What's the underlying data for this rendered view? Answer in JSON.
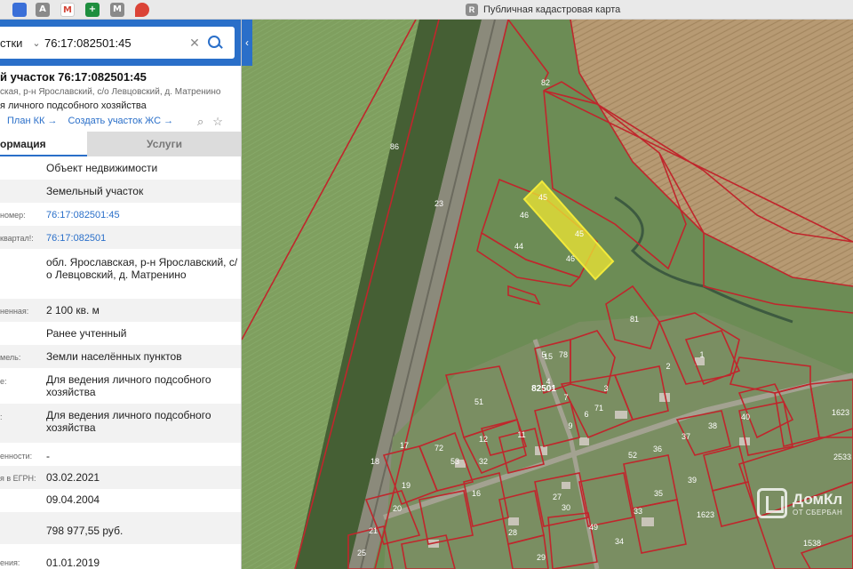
{
  "browser": {
    "favicons": [
      {
        "name": "fav-edge-icon",
        "label": "",
        "color": "#3a6fd8"
      },
      {
        "name": "fav-a-icon",
        "label": "A",
        "color": "#8a8a8a"
      },
      {
        "name": "fav-gmail-icon",
        "label": "M",
        "color": "#d44638"
      },
      {
        "name": "fav-sheets-icon",
        "label": "+",
        "color": "#1e8e3e"
      },
      {
        "name": "fav-m-icon",
        "label": "M",
        "color": "#8a8a8a"
      },
      {
        "name": "fav-maps-icon",
        "label": "",
        "color": "#db4437"
      }
    ],
    "tab_icon": "R",
    "tab_title": "Публичная кадастровая карта"
  },
  "search": {
    "type_label": "стки",
    "value": "76:17:082501:45",
    "placeholder": ""
  },
  "object": {
    "title": "й участок 76:17:082501:45",
    "address_short": "ская, р-н Ярославский, с/о Левцовский, д. Матренино",
    "use_short": "я личного подсобного хозяйства",
    "link_plan": "План КК →",
    "link_create": "Создать участок ЖС →"
  },
  "tabs": {
    "info": "ормация",
    "services": "Услуги"
  },
  "rows": [
    {
      "label": "",
      "value": "Объект недвижимости"
    },
    {
      "label": "",
      "value": "Земельный участок"
    },
    {
      "label": "номер:",
      "value": "76:17:082501:45"
    },
    {
      "label": "квартал!:",
      "value": "76:17:082501"
    },
    {
      "label": "",
      "value": "обл. Ярославская, р-н Ярославский, с/о Левцовский, д. Матренино"
    },
    {
      "label": "ненная:",
      "value": "2 100 кв. м"
    },
    {
      "label": "",
      "value": "Ранее учтенный"
    },
    {
      "label": "мель:",
      "value": "Земли населённых пунктов"
    },
    {
      "label": "е:",
      "value": "Для ведения личного подсобного хозяйства"
    },
    {
      "label": ":",
      "value": "Для ведения личного подсобного хозяйства"
    },
    {
      "label": "енности:",
      "value": "-"
    },
    {
      "label": "я в ЕГРН:",
      "value": "03.02.2021"
    },
    {
      "label": "",
      "value": "09.04.2004"
    },
    {
      "label": "",
      "value": "798 977,55 руб."
    },
    {
      "label": "ения:",
      "value": "01.01.2019"
    }
  ],
  "map": {
    "collapse": "‹",
    "quarter_label": "82501",
    "parcels": [
      "86",
      "23",
      "82",
      "46",
      "44",
      "46",
      "45",
      "45",
      "81",
      "1",
      "2",
      "3",
      "4",
      "5",
      "6",
      "7",
      "9",
      "11",
      "12",
      "15",
      "16",
      "17",
      "18",
      "19",
      "20",
      "21",
      "25",
      "27",
      "28",
      "29",
      "30",
      "32",
      "33",
      "34",
      "35",
      "36",
      "37",
      "38",
      "39",
      "40",
      "49",
      "51",
      "52",
      "53",
      "71",
      "72",
      "78",
      "1623",
      "1623",
      "2533",
      "1538"
    ],
    "watermark_t1": "ДомКл",
    "watermark_t2": "ОТ СБЕРБАН"
  },
  "colors": {
    "accent": "#2a6fc9",
    "parcel_border": "#c0262c",
    "selected_fill": "#e8e135"
  }
}
